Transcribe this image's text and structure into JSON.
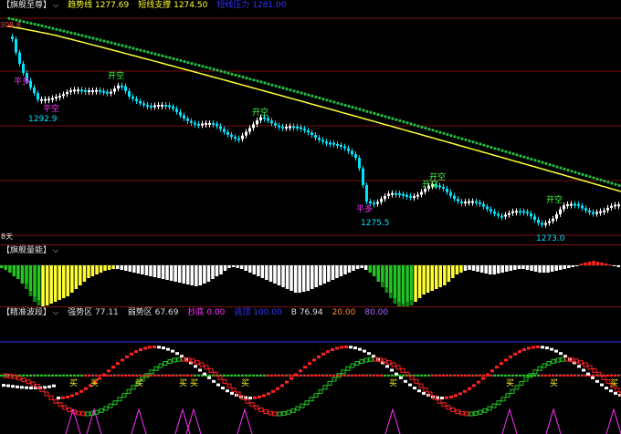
{
  "colors": {
    "background": "#000000",
    "candle_up": "#ffffff",
    "candle_down": "#00e5ff",
    "trend_line": "#ffff33",
    "support_dots": "#22bb44",
    "volume_pos": "#ffff33",
    "volume_neg": "#ffffff",
    "volume_green": "#22c522",
    "volume_red": "#ff2222",
    "grid_red": "#7a1010",
    "blue_line": "#3333ff"
  },
  "main": {
    "title": "【旗舰至尊】",
    "trend_label": "趋势线",
    "trend_value": "1277.69",
    "support_label": "短线支撑",
    "support_value": "1274.50",
    "pressure_label": "短线压力",
    "pressure_value": "1281.00",
    "top_price": "308.8",
    "left_label": "8天",
    "annotations": [
      {
        "text": "1292.9",
        "kind": "price"
      },
      {
        "text": "1275.5",
        "kind": "price"
      },
      {
        "text": "1273.0",
        "kind": "price"
      },
      {
        "text": "开空",
        "kind": "signal"
      },
      {
        "text": "开空",
        "kind": "signal"
      },
      {
        "text": "开空",
        "kind": "signal"
      },
      {
        "text": "开空",
        "kind": "signal"
      },
      {
        "text": "开空",
        "kind": "signal"
      },
      {
        "text": "平多",
        "kind": "close"
      },
      {
        "text": "平多",
        "kind": "close"
      },
      {
        "text": "平空",
        "kind": "close"
      }
    ]
  },
  "volume": {
    "title": "【旗舰量能】",
    "values": [
      -3,
      -5,
      -8,
      -12,
      -15,
      -20,
      -26,
      -34,
      -40,
      -44,
      -46,
      -44,
      -42,
      -40,
      -38,
      -36,
      -34,
      -30,
      -26,
      -22,
      -18,
      -14,
      -12,
      -10,
      -8,
      -6,
      -5,
      -4,
      -4,
      -5,
      -6,
      -7,
      -8,
      -9,
      -10,
      -11,
      -12,
      -13,
      -14,
      -15,
      -16,
      -17,
      -18,
      -19,
      -20,
      -21,
      -22,
      -23,
      -22,
      -20,
      -18,
      -15,
      -12,
      -10,
      -6,
      -3,
      -2,
      -3,
      -4,
      -6,
      -8,
      -10,
      -12,
      -14,
      -16,
      -18,
      -20,
      -22,
      -24,
      -26,
      -28,
      -30,
      -30,
      -29,
      -28,
      -26,
      -24,
      -22,
      -20,
      -18,
      -16,
      -14,
      -12,
      -10,
      -8,
      -6,
      -4,
      -3,
      -5,
      -8,
      -12,
      -18,
      -24,
      -30,
      -36,
      -42,
      -46,
      -48,
      -46,
      -44,
      -40,
      -36,
      -32,
      -30,
      -28,
      -26,
      -24,
      -22,
      -18,
      -14,
      -10,
      -8,
      -6,
      -5,
      -6,
      -7,
      -8,
      -9,
      -10,
      -10,
      -9,
      -8,
      -7,
      -6,
      -5,
      -4,
      -4,
      -5,
      -6,
      -7,
      -8,
      -8,
      -8,
      -7,
      -6,
      -5,
      -4,
      -3,
      -2,
      -1,
      2,
      3,
      4,
      5,
      4,
      3,
      2,
      1,
      -1,
      -2
    ]
  },
  "wave": {
    "title": "精准波段",
    "strong_label": "强势区",
    "strong_value": "77.11",
    "weak_label": "弱势区",
    "weak_value": "67.69",
    "bottom_label": "抄底",
    "bottom_value": "0.00",
    "top_label": "逃顶",
    "top_value": "100.00",
    "b_label": "B",
    "b_value": "76.94",
    "v20": "20.00",
    "v80": "80.00",
    "buy_marks": [
      "买",
      "买",
      "买",
      "买",
      "买",
      "买",
      "买",
      "买",
      "买",
      "买"
    ]
  }
}
